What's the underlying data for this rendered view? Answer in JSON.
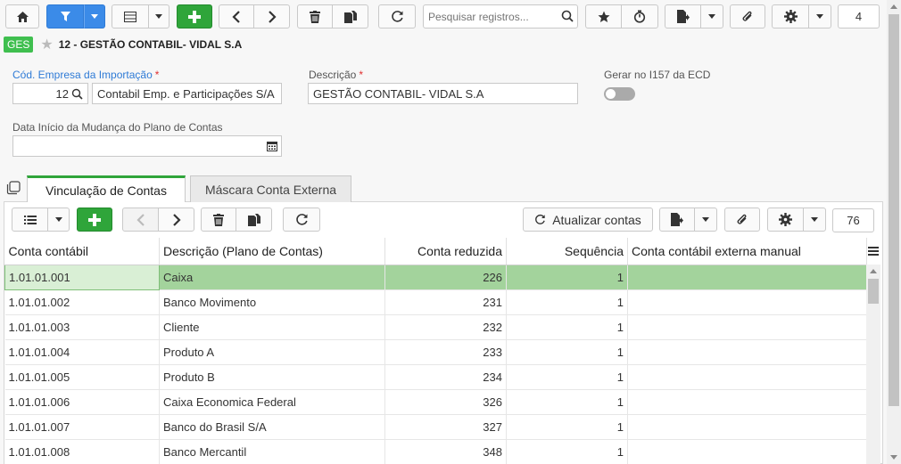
{
  "toolbar": {
    "search_placeholder": "Pesquisar registros...",
    "record_count": "4"
  },
  "title": {
    "badge": "GES",
    "text": "12 - GESTÃO CONTABIL- VIDAL S.A"
  },
  "form": {
    "cod_empresa_label": "Cód. Empresa da Importação",
    "cod_empresa_value": "12",
    "empresa_name": "Contabil Emp. e Participações S/A",
    "descricao_label": "Descrição",
    "descricao_value": "GESTÃO CONTABIL- VIDAL S.A",
    "gerar_label": "Gerar no I157 da ECD",
    "gerar_value": false,
    "data_inicio_label": "Data Início da Mudança do Plano de Contas",
    "data_inicio_value": "",
    "required_mark": "*"
  },
  "tabs": [
    {
      "label": "Vinculação de Contas",
      "active": true
    },
    {
      "label": "Máscara Conta Externa",
      "active": false
    }
  ],
  "subtoolbar": {
    "atualizar_label": "Atualizar contas",
    "record_count": "76"
  },
  "grid": {
    "columns": [
      "Conta contábil",
      "Descrição (Plano de Contas)",
      "Conta reduzida",
      "Sequência",
      "Conta contábil externa manual"
    ],
    "rows": [
      {
        "conta": "1.01.01.001",
        "descricao": "Caixa",
        "reduzida": "226",
        "sequencia": "1",
        "externa": ""
      },
      {
        "conta": "1.01.01.002",
        "descricao": "Banco Movimento",
        "reduzida": "231",
        "sequencia": "1",
        "externa": ""
      },
      {
        "conta": "1.01.01.003",
        "descricao": "Cliente",
        "reduzida": "232",
        "sequencia": "1",
        "externa": ""
      },
      {
        "conta": "1.01.01.004",
        "descricao": "Produto A",
        "reduzida": "233",
        "sequencia": "1",
        "externa": ""
      },
      {
        "conta": "1.01.01.005",
        "descricao": "Produto B",
        "reduzida": "234",
        "sequencia": "1",
        "externa": ""
      },
      {
        "conta": "1.01.01.006",
        "descricao": "Caixa Economica Federal",
        "reduzida": "326",
        "sequencia": "1",
        "externa": ""
      },
      {
        "conta": "1.01.01.007",
        "descricao": "Banco do Brasil S/A",
        "reduzida": "327",
        "sequencia": "1",
        "externa": ""
      },
      {
        "conta": "1.01.01.008",
        "descricao": "Banco Mercantil",
        "reduzida": "348",
        "sequencia": "1",
        "externa": ""
      }
    ]
  },
  "colors": {
    "accent_blue": "#3b8be8",
    "accent_green": "#2fa53a",
    "selected_row": "#a3d39c"
  }
}
